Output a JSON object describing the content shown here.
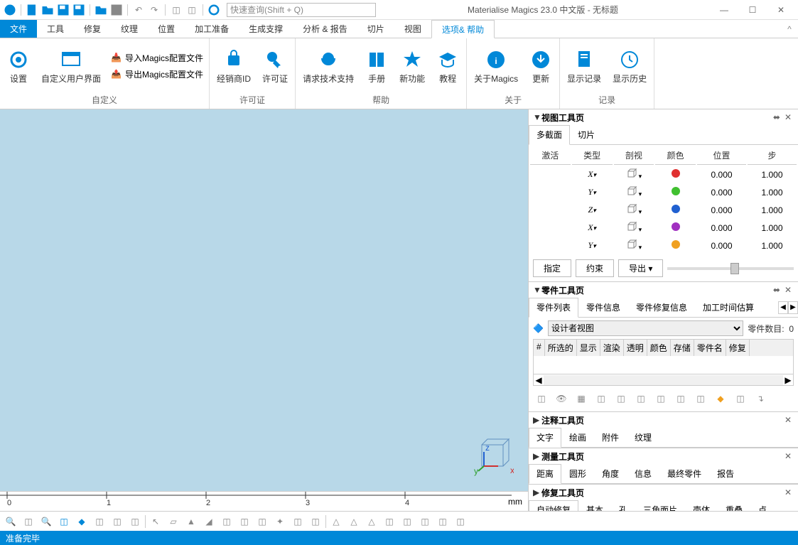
{
  "app": {
    "title": "Materialise Magics 23.0 中文版 - 无标题",
    "search_placeholder": "快速查询(Shift + Q)"
  },
  "menu": {
    "tabs": [
      "文件",
      "工具",
      "修复",
      "纹理",
      "位置",
      "加工准备",
      "生成支撑",
      "分析 & 报告",
      "切片",
      "视图",
      "选项& 帮助"
    ]
  },
  "ribbon": {
    "groups": [
      {
        "label": "自定义",
        "buttons": [
          {
            "l": "设置"
          },
          {
            "l": "自定义用户界面"
          }
        ],
        "small": [
          {
            "l": "导入Magics配置文件"
          },
          {
            "l": "导出Magics配置文件"
          }
        ]
      },
      {
        "label": "许可证",
        "buttons": [
          {
            "l": "经销商ID"
          },
          {
            "l": "许可证"
          }
        ]
      },
      {
        "label": "帮助",
        "buttons": [
          {
            "l": "请求技术支持"
          },
          {
            "l": "手册"
          },
          {
            "l": "新功能"
          },
          {
            "l": "教程"
          }
        ]
      },
      {
        "label": "关于",
        "buttons": [
          {
            "l": "关于Magics"
          },
          {
            "l": "更新"
          }
        ]
      },
      {
        "label": "记录",
        "buttons": [
          {
            "l": "显示记录"
          },
          {
            "l": "显示历史"
          }
        ]
      }
    ]
  },
  "ruler": {
    "ticks": [
      "0",
      "1",
      "2",
      "3",
      "4"
    ],
    "unit": "mm"
  },
  "panels": {
    "view": {
      "title": "视图工具页",
      "tabs": [
        "多截面",
        "切片"
      ],
      "headers": [
        "激活",
        "类型",
        "剖视",
        "颜色",
        "位置",
        "步"
      ],
      "rows": [
        {
          "t": "X",
          "c": "#e03030",
          "p": "0.000",
          "s": "1.000"
        },
        {
          "t": "Y",
          "c": "#40c030",
          "p": "0.000",
          "s": "1.000"
        },
        {
          "t": "Z",
          "c": "#2060d0",
          "p": "0.000",
          "s": "1.000"
        },
        {
          "t": "X",
          "c": "#a030c0",
          "p": "0.000",
          "s": "1.000"
        },
        {
          "t": "Y",
          "c": "#f0a020",
          "p": "0.000",
          "s": "1.000"
        }
      ],
      "actions": [
        "指定",
        "约束",
        "导出"
      ]
    },
    "part": {
      "title": "零件工具页",
      "tabs": [
        "零件列表",
        "零件信息",
        "零件修复信息",
        "加工时间估算"
      ],
      "view": "设计者视图",
      "count_label": "零件数目:",
      "count": "0",
      "cols": [
        "#",
        "所选的",
        "显示",
        "渲染",
        "透明",
        "颜色",
        "存储",
        "零件名",
        "修复"
      ]
    },
    "annotate": {
      "title": "注释工具页",
      "tabs": [
        "文字",
        "绘画",
        "附件",
        "纹理"
      ]
    },
    "measure": {
      "title": "测量工具页",
      "tabs": [
        "距离",
        "圆形",
        "角度",
        "信息",
        "最终零件",
        "报告"
      ]
    },
    "fix": {
      "title": "修复工具页",
      "tabs": [
        "自动修复",
        "基本",
        "孔",
        "三角面片",
        "壳体",
        "重叠",
        "点"
      ]
    }
  },
  "status": "准备完毕"
}
